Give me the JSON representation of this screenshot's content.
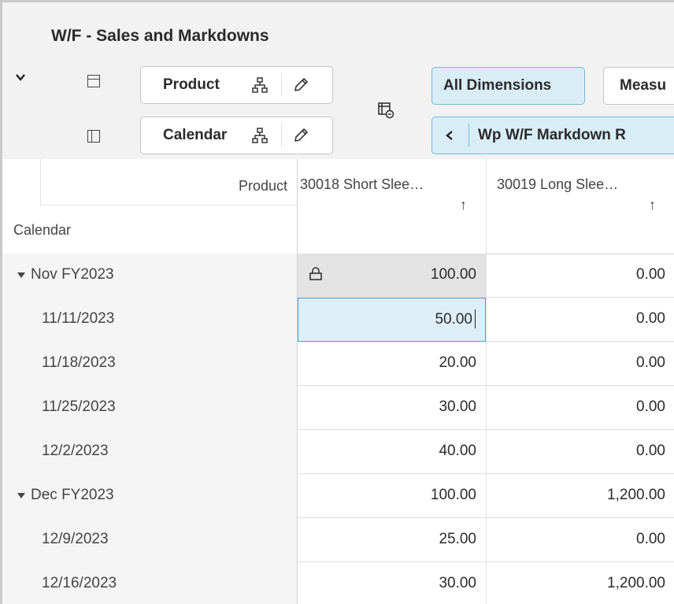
{
  "window": {
    "title": "W/F - Sales and Markdowns"
  },
  "toolbar": {
    "dimensions": [
      {
        "label": "Product"
      },
      {
        "label": "Calendar"
      }
    ],
    "all_dimensions_label": "All Dimensions",
    "measures_label": "Measu",
    "measure_nav_label": "Wp W/F Markdown R"
  },
  "grid": {
    "row_dimension_label": "Calendar",
    "column_dimension_label": "Product",
    "columns": [
      {
        "label": "30018 Short Slee…",
        "sort": "↑"
      },
      {
        "label": "30019 Long Slee…",
        "sort": "↑"
      }
    ],
    "rows": [
      {
        "label": "Nov FY2023",
        "values": [
          "100.00",
          "0.00"
        ]
      },
      {
        "label": "11/11/2023",
        "values": [
          "50.00",
          "0.00"
        ]
      },
      {
        "label": "11/18/2023",
        "values": [
          "20.00",
          "0.00"
        ]
      },
      {
        "label": "11/25/2023",
        "values": [
          "30.00",
          "0.00"
        ]
      },
      {
        "label": "12/2/2023",
        "values": [
          "40.00",
          "0.00"
        ]
      },
      {
        "label": "Dec FY2023",
        "values": [
          "100.00",
          "1,200.00"
        ]
      },
      {
        "label": "12/9/2023",
        "values": [
          "25.00",
          "0.00"
        ]
      },
      {
        "label": "12/16/2023",
        "values": [
          "30.00",
          "1,200.00"
        ]
      }
    ]
  },
  "icons": {
    "collapse": "chevron-down-icon",
    "row_layout": "row-layout-icon",
    "column_layout": "column-layout-icon",
    "hierarchy": "hierarchy-icon",
    "edit": "pencil-icon",
    "pivot": "pivot-icon",
    "back": "chevron-left-icon",
    "lock": "lock-icon",
    "expand": "caret-down-icon"
  },
  "colors": {
    "header_bg": "#f2f2f2",
    "selected_button_bg": "#d9edf7",
    "selected_button_border": "#7ab8d6",
    "active_cell_bg": "#ddeef7",
    "active_cell_border": "#4d9fcc",
    "locked_cell_bg": "#e3e3e3",
    "row_label_bg": "#f5f5f5"
  }
}
